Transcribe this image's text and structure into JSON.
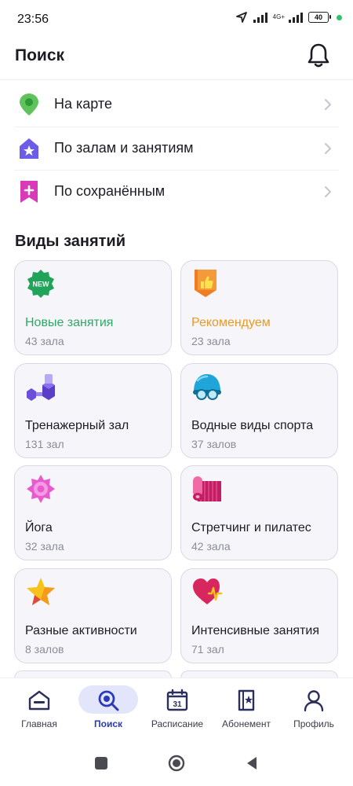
{
  "status": {
    "time": "23:56",
    "network": "4G+",
    "battery": "40"
  },
  "header": {
    "title": "Поиск"
  },
  "search_options": [
    {
      "label": "На карте",
      "icon": "map-pin-icon"
    },
    {
      "label": "По залам и занятиям",
      "icon": "star-house-icon"
    },
    {
      "label": "По сохранённым",
      "icon": "bookmark-plus-icon"
    }
  ],
  "section": {
    "title": "Виды занятий"
  },
  "categories": [
    {
      "title": "Новые занятия",
      "count": "43 зала",
      "icon": "new-badge-icon",
      "title_color": "#2ea866"
    },
    {
      "title": "Рекомендуем",
      "count": "23 зала",
      "icon": "thumbs-up-shield-icon",
      "title_color": "#e89a26"
    },
    {
      "title": "Тренажерный зал",
      "count": "131 зал",
      "icon": "dumbbell-icon",
      "title_color": "#1c1c24"
    },
    {
      "title": "Водные виды спорта",
      "count": "37 залов",
      "icon": "swim-cap-icon",
      "title_color": "#1c1c24"
    },
    {
      "title": "Йога",
      "count": "32 зала",
      "icon": "lotus-icon",
      "title_color": "#1c1c24"
    },
    {
      "title": "Стретчинг и пилатес",
      "count": "42 зала",
      "icon": "yoga-mat-icon",
      "title_color": "#1c1c24"
    },
    {
      "title": "Разные активности",
      "count": "8 залов",
      "icon": "star-icon",
      "title_color": "#1c1c24"
    },
    {
      "title": "Интенсивные занятия",
      "count": "71 зал",
      "icon": "heart-pulse-icon",
      "title_color": "#1c1c24"
    }
  ],
  "tabs": [
    {
      "label": "Главная",
      "icon": "home-icon",
      "active": false
    },
    {
      "label": "Поиск",
      "icon": "search-icon",
      "active": true
    },
    {
      "label": "Расписание",
      "icon": "calendar-icon",
      "active": false,
      "calendar_day": "31"
    },
    {
      "label": "Абонемент",
      "icon": "pass-card-icon",
      "active": false
    },
    {
      "label": "Профиль",
      "icon": "profile-icon",
      "active": false
    }
  ],
  "colors": {
    "accent": "#2b3bb5",
    "active_pill": "#e3e6fb",
    "card_bg": "#f6f6fa",
    "card_border": "#d9d9e6"
  }
}
